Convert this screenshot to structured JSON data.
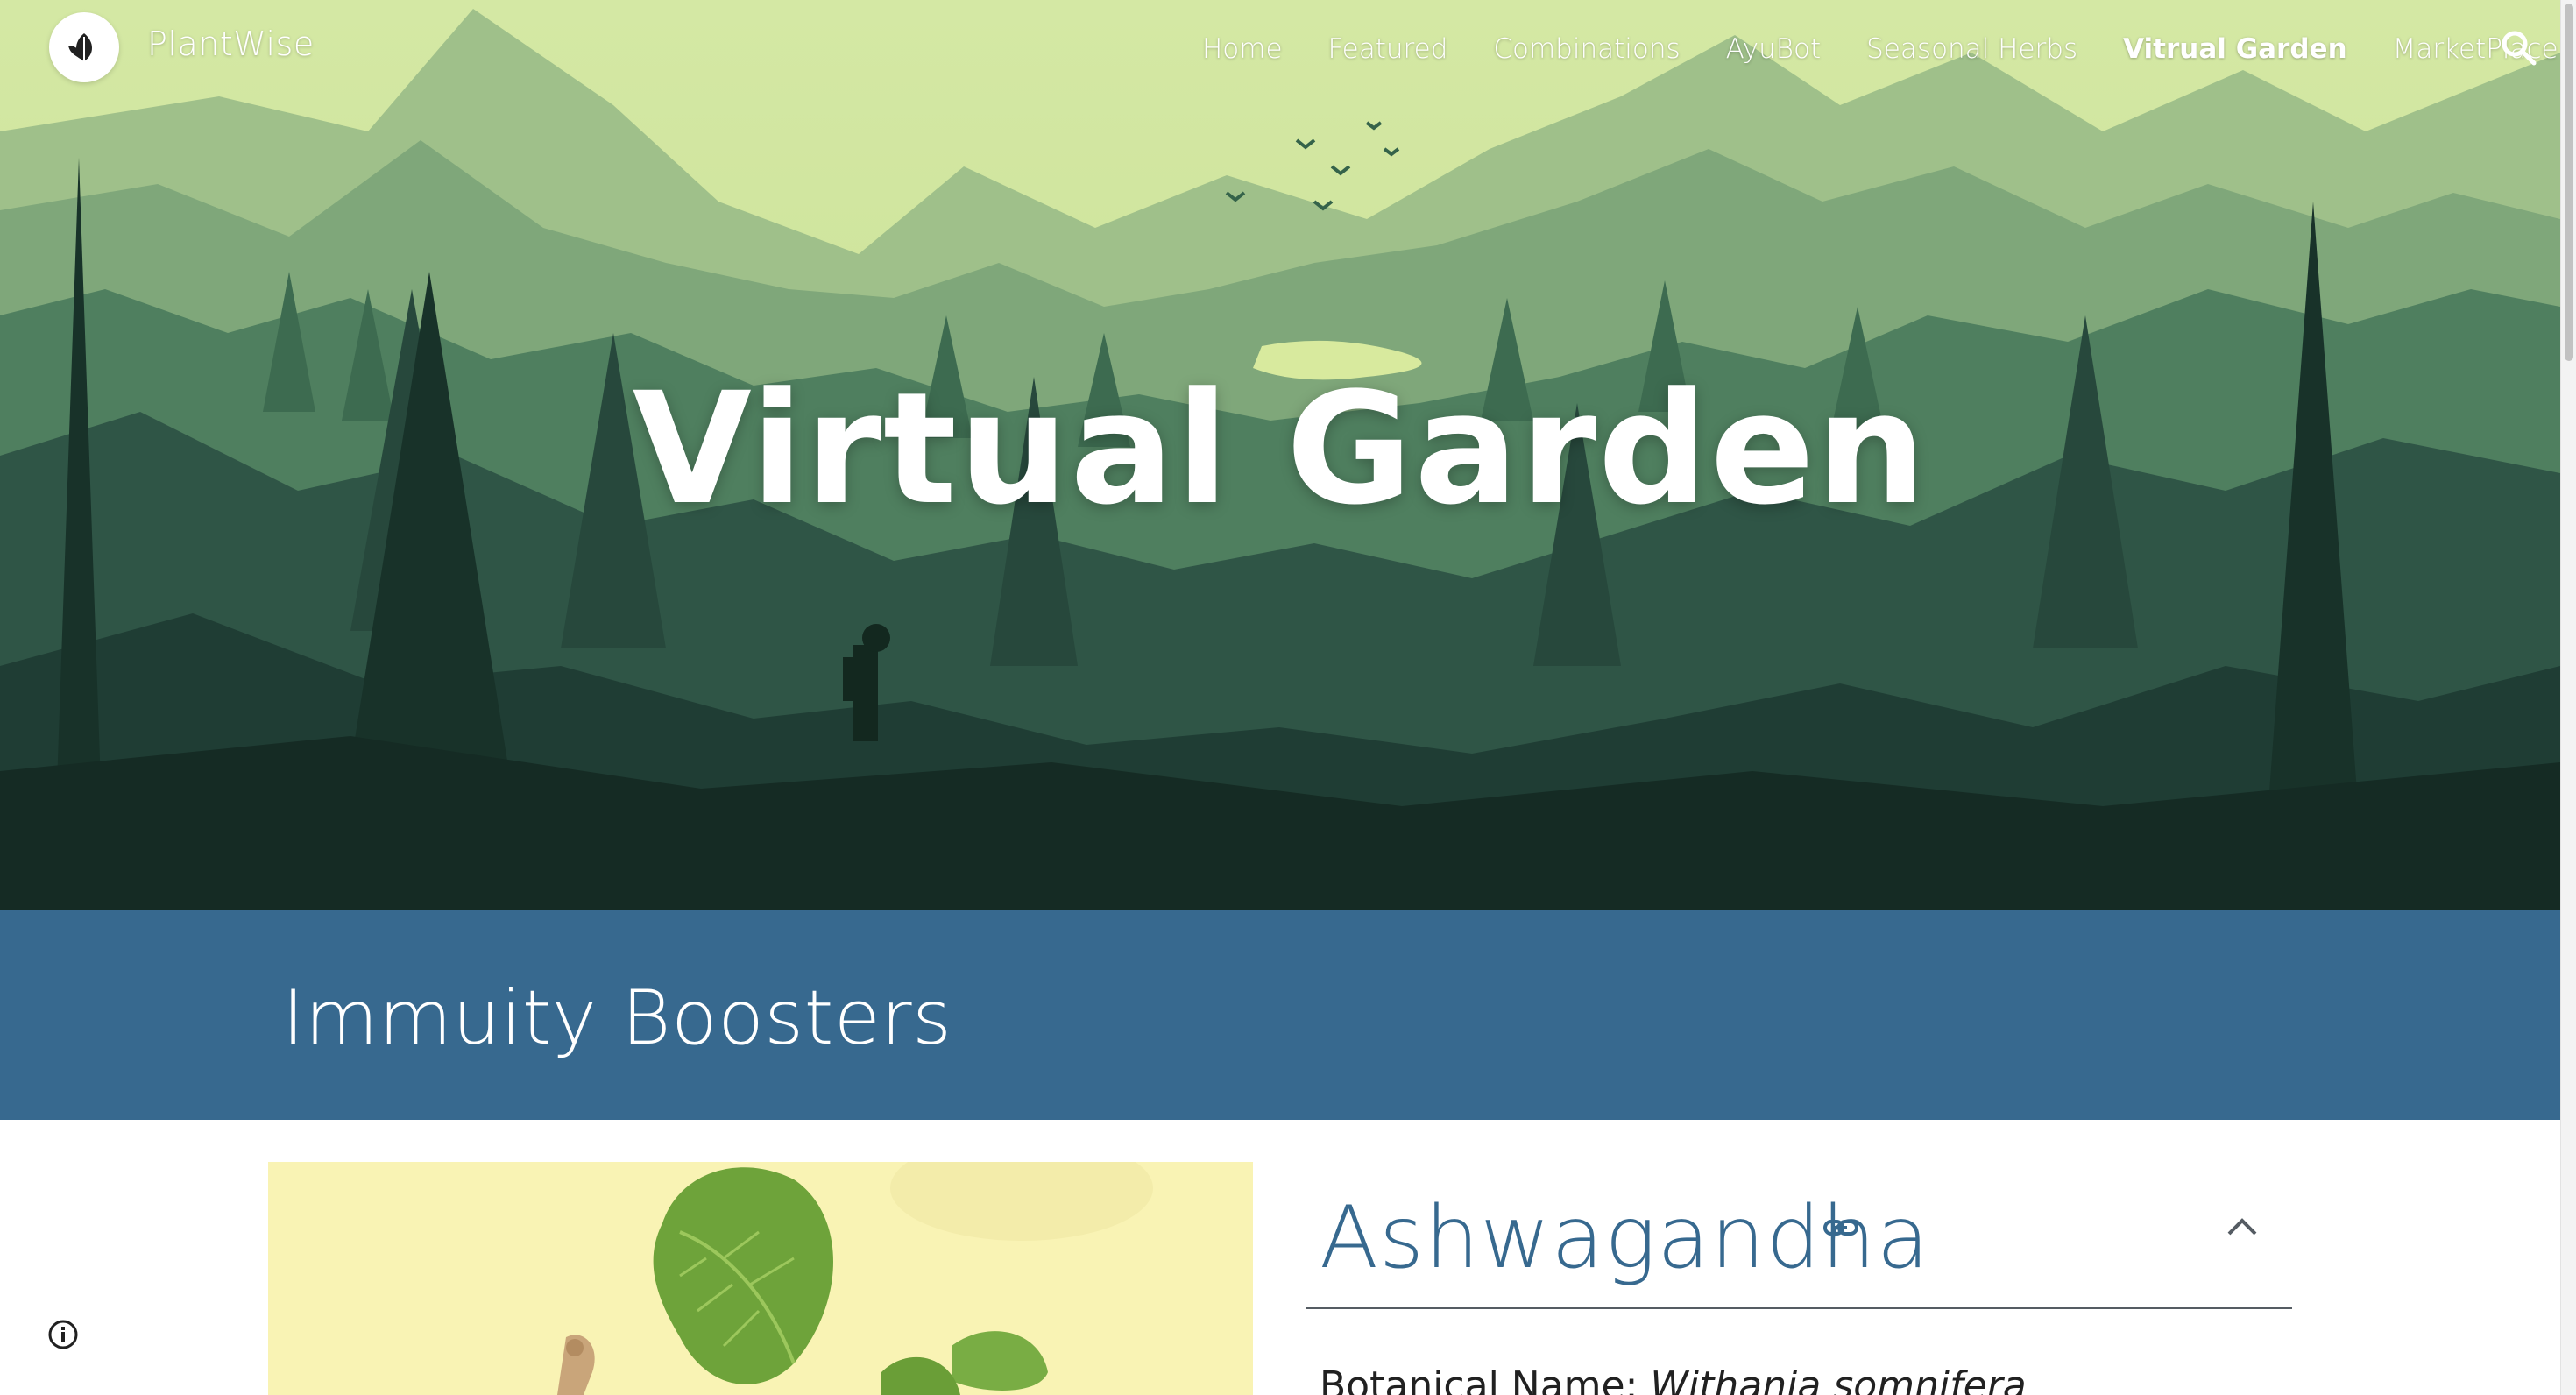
{
  "site": {
    "name": "PlantWise"
  },
  "nav": {
    "items": [
      {
        "label": "Home",
        "active": false
      },
      {
        "label": "Featured",
        "active": false
      },
      {
        "label": "Combinations",
        "active": false
      },
      {
        "label": "AyuBot",
        "active": false
      },
      {
        "label": "Seasonal Herbs",
        "active": false
      },
      {
        "label": "Vitrual Garden",
        "active": true
      },
      {
        "label": "MarketPlace",
        "active": false
      }
    ],
    "search_icon": "search-icon"
  },
  "hero": {
    "title": "Virtual Garden"
  },
  "section": {
    "title": "Immuity Boosters"
  },
  "herb": {
    "name": "Ashwagandha",
    "botanical_label": "Botanical Name:",
    "botanical_value": "Withania somnifera",
    "link_icon": "link-icon",
    "collapse_icon": "chevron-up-icon"
  },
  "footer": {
    "info_icon": "info-icon"
  },
  "colors": {
    "accent": "#37698f",
    "hero_sky": "#cfe39c",
    "hero_dark": "#15302c"
  }
}
